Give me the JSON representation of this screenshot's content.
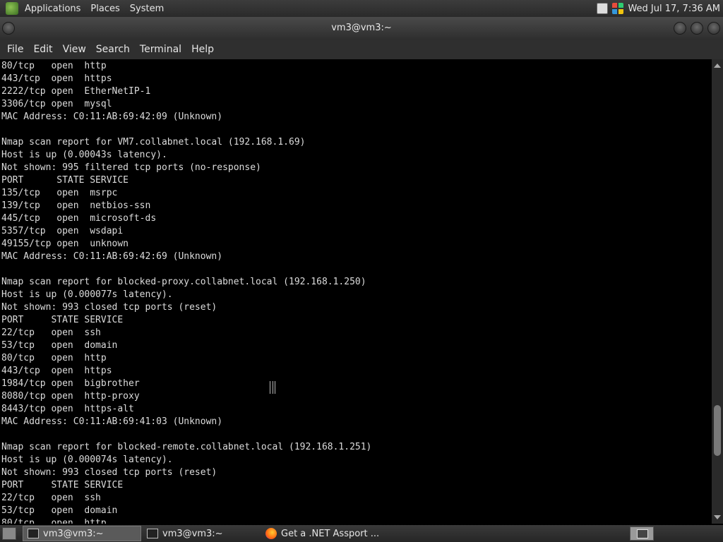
{
  "top_panel": {
    "menus": [
      "Applications",
      "Places",
      "System"
    ],
    "clock": "Wed Jul 17,  7:36 AM"
  },
  "window": {
    "title": "vm3@vm3:~"
  },
  "menubar": [
    "File",
    "Edit",
    "View",
    "Search",
    "Terminal",
    "Help"
  ],
  "terminal": {
    "lines": [
      "80/tcp   open  http",
      "443/tcp  open  https",
      "2222/tcp open  EtherNetIP-1",
      "3306/tcp open  mysql",
      "MAC Address: C0:11:AB:69:42:09 (Unknown)",
      "",
      "Nmap scan report for VM7.collabnet.local (192.168.1.69)",
      "Host is up (0.00043s latency).",
      "Not shown: 995 filtered tcp ports (no-response)",
      "PORT      STATE SERVICE",
      "135/tcp   open  msrpc",
      "139/tcp   open  netbios-ssn",
      "445/tcp   open  microsoft-ds",
      "5357/tcp  open  wsdapi",
      "49155/tcp open  unknown",
      "MAC Address: C0:11:AB:69:42:69 (Unknown)",
      "",
      "Nmap scan report for blocked-proxy.collabnet.local (192.168.1.250)",
      "Host is up (0.000077s latency).",
      "Not shown: 993 closed tcp ports (reset)",
      "PORT     STATE SERVICE",
      "22/tcp   open  ssh",
      "53/tcp   open  domain",
      "80/tcp   open  http",
      "443/tcp  open  https",
      "1984/tcp open  bigbrother",
      "8080/tcp open  http-proxy",
      "8443/tcp open  https-alt",
      "MAC Address: C0:11:AB:69:41:03 (Unknown)",
      "",
      "Nmap scan report for blocked-remote.collabnet.local (192.168.1.251)",
      "Host is up (0.000074s latency).",
      "Not shown: 993 closed tcp ports (reset)",
      "PORT     STATE SERVICE",
      "22/tcp   open  ssh",
      "53/tcp   open  domain",
      "80/tcp   open  http"
    ]
  },
  "taskbar": {
    "tasks": [
      "vm3@vm3:~",
      "vm3@vm3:~",
      "Get a .NET Assport ..."
    ]
  }
}
